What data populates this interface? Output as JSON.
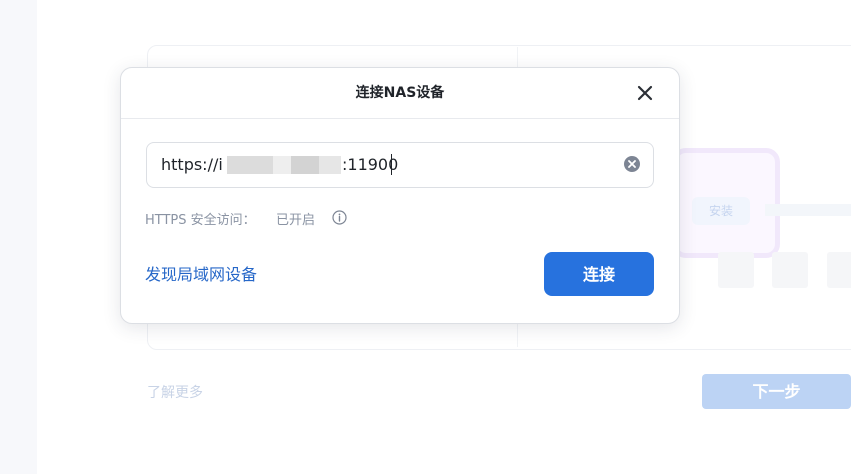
{
  "background": {
    "install_label": "安装",
    "learn_more": "了解更多",
    "next_button": "下一步"
  },
  "dialog": {
    "title": "连接NAS设备",
    "close_icon": "close-icon",
    "url": {
      "prefix": "https://",
      "visible_char": "i",
      "port": ":11900",
      "clear_icon": "clear-circle-icon"
    },
    "https_label": "HTTPS 安全访问：",
    "https_value": "已开启",
    "info_icon": "info-icon",
    "discover_link": "发现局域网设备",
    "connect_button": "连接"
  },
  "colors": {
    "primary": "#2772de",
    "link": "#2667c8",
    "next_disabled": "#bcd3f4"
  }
}
